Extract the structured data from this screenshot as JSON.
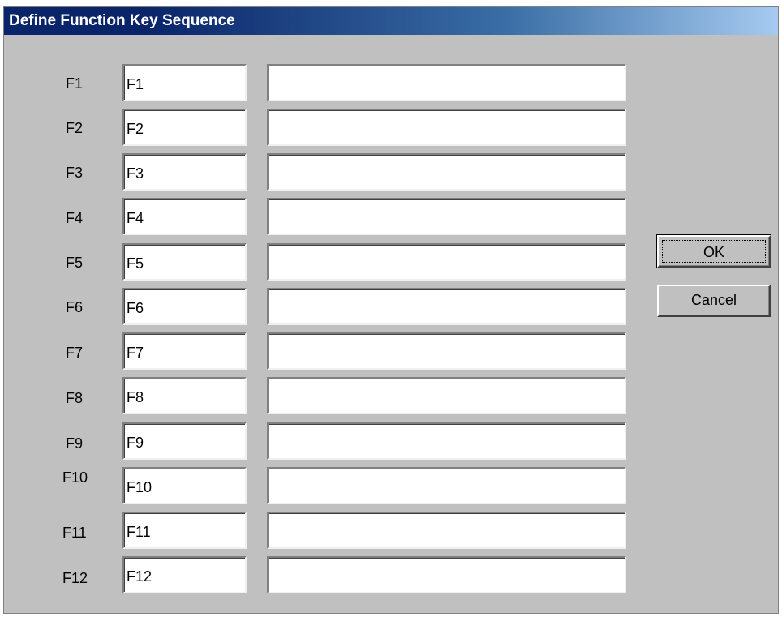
{
  "dialog": {
    "title": "Define Function Key Sequence"
  },
  "keys": [
    {
      "label": "F1",
      "name": "F1",
      "sequence": ""
    },
    {
      "label": "F2",
      "name": "F2",
      "sequence": ""
    },
    {
      "label": "F3",
      "name": "F3",
      "sequence": ""
    },
    {
      "label": "F4",
      "name": "F4",
      "sequence": ""
    },
    {
      "label": "F5",
      "name": "F5",
      "sequence": ""
    },
    {
      "label": "F6",
      "name": "F6",
      "sequence": ""
    },
    {
      "label": "F7",
      "name": "F7",
      "sequence": ""
    },
    {
      "label": "F8",
      "name": "F8",
      "sequence": ""
    },
    {
      "label": "F9",
      "name": "F9",
      "sequence": ""
    },
    {
      "label": "F10",
      "name": "F10",
      "sequence": ""
    },
    {
      "label": "F11",
      "name": "F11",
      "sequence": ""
    },
    {
      "label": "F12",
      "name": "F12",
      "sequence": ""
    }
  ],
  "buttons": {
    "ok_label": "OK",
    "cancel_label": "Cancel"
  },
  "colors": {
    "titlebar_start": "#0a246a",
    "titlebar_end": "#a6caf0",
    "dialog_background": "#c0c0c0",
    "field_background": "#ffffff"
  }
}
